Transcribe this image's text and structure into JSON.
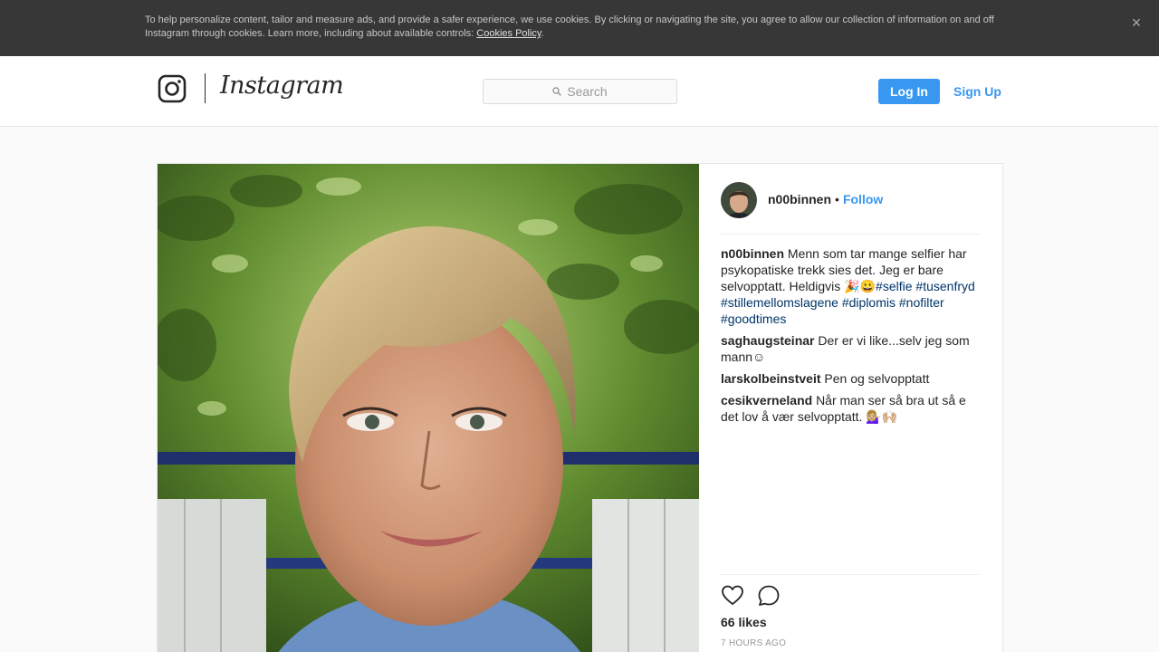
{
  "cookie_banner": {
    "text": "To help personalize content, tailor and measure ads, and provide a safer experience, we use cookies. By clicking or navigating the site, you agree to allow our collection of information on and off Instagram through cookies. Learn more, including about available controls: ",
    "link_text": "Cookies Policy",
    "close_icon": "×"
  },
  "header": {
    "logo_icon": "instagram-camera-icon",
    "wordmark": "Instagram",
    "search_placeholder": "Search",
    "login_label": "Log In",
    "signup_label": "Sign Up"
  },
  "post": {
    "username": "n00binnen",
    "separator": "•",
    "follow_label": "Follow",
    "caption": {
      "user": "n00binnen",
      "text": "Menn som tar mange selfier har psykopatiske trekk sies det. Jeg er bare selvopptatt. Heldigvis 🎉😀",
      "hashtags": [
        "#selfie",
        "#tusenfryd",
        "#stillemellomslagene",
        "#diplomis",
        "#nofilter",
        "#goodtimes"
      ]
    },
    "comments": [
      {
        "user": "saghaugsteinar",
        "text": "Der er vi like...selv jeg som mann☺"
      },
      {
        "user": "larskolbeinstveit",
        "text": "Pen og selvopptatt"
      },
      {
        "user": "cesikverneland",
        "text": "Når man ser så bra ut så e det lov å vær selvopptatt. 💁🏼‍♀️🙌🏼"
      }
    ],
    "likes": "66 likes",
    "time": "7 HOURS AGO",
    "icons": {
      "like": "heart-icon",
      "comment": "comment-bubble-icon"
    }
  },
  "colors": {
    "banner_bg": "#373737",
    "accent": "#3897f0",
    "hashtag": "#003569"
  }
}
